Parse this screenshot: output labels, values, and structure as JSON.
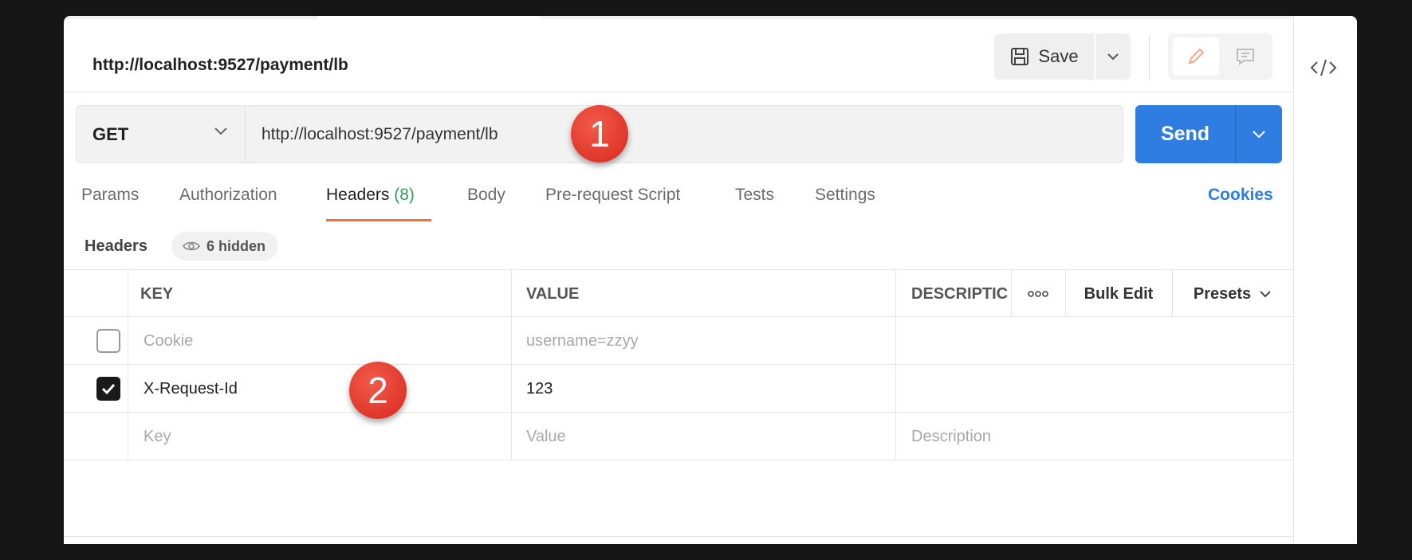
{
  "request": {
    "title": "http://localhost:9527/payment/lb",
    "method": "GET",
    "url": "http://localhost:9527/payment/lb"
  },
  "toolbar": {
    "save_label": "Save",
    "send_label": "Send"
  },
  "annotations": [
    "1",
    "2"
  ],
  "tabs": [
    {
      "label": "Params"
    },
    {
      "label": "Authorization"
    },
    {
      "label": "Headers",
      "count": "(8)",
      "active": true
    },
    {
      "label": "Body"
    },
    {
      "label": "Pre-request Script"
    },
    {
      "label": "Tests"
    },
    {
      "label": "Settings"
    }
  ],
  "cookies_label": "Cookies",
  "headers_section": {
    "label": "Headers",
    "hidden_label": "6 hidden"
  },
  "table": {
    "columns": [
      "KEY",
      "VALUE",
      "DESCRIPTIC",
      "Bulk Edit",
      "Presets"
    ],
    "rows": [
      {
        "checked": false,
        "key": "Cookie",
        "value": "username=zzyy",
        "description": ""
      },
      {
        "checked": true,
        "key": "X-Request-Id",
        "value": "123",
        "description": ""
      }
    ],
    "new_row": {
      "key": "Key",
      "value": "Value",
      "description": "Description"
    }
  },
  "colors": {
    "accent_blue": "#2f7de1",
    "tab_underline": "#ff6c37",
    "count_green": "#2f9e5a",
    "badge_red": "#d8281c"
  },
  "icons": [
    "save-icon",
    "chevron-down-icon",
    "edit-icon",
    "comment-icon",
    "code-icon",
    "eye-icon",
    "more-icon",
    "checkmark-icon"
  ]
}
